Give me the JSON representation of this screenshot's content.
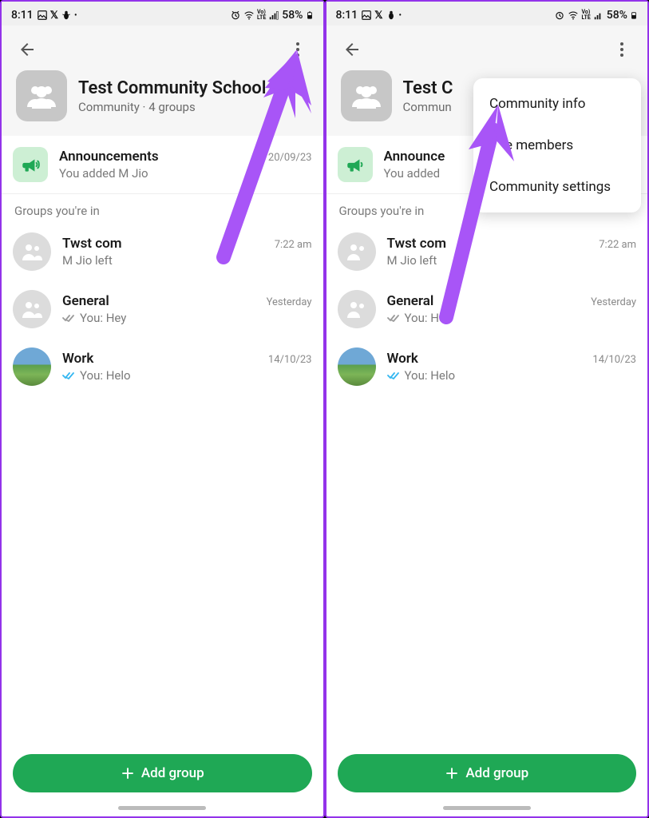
{
  "status_bar": {
    "time": "8:11",
    "battery": "58%"
  },
  "header": {
    "title": "Test Community School",
    "title_truncated": "Test C",
    "subtitle": "Community · 4 groups"
  },
  "announcements": {
    "title": "Announcements",
    "subtitle": "You added M Jio",
    "time": "20/09/23"
  },
  "section_label": "Groups you're in",
  "groups": [
    {
      "name": "Twst com",
      "subtitle": "M Jio left",
      "time": "7:22 am",
      "ticks": "none"
    },
    {
      "name": "General",
      "subtitle": "You: Hey",
      "time": "Yesterday",
      "ticks": "gray"
    },
    {
      "name": "Work",
      "subtitle": "You: Helo",
      "time": "14/10/23",
      "ticks": "blue"
    }
  ],
  "menu": {
    "item1": "Community info",
    "item2_visible": "e members",
    "item3": "Community settings"
  },
  "add_group": "Add group"
}
